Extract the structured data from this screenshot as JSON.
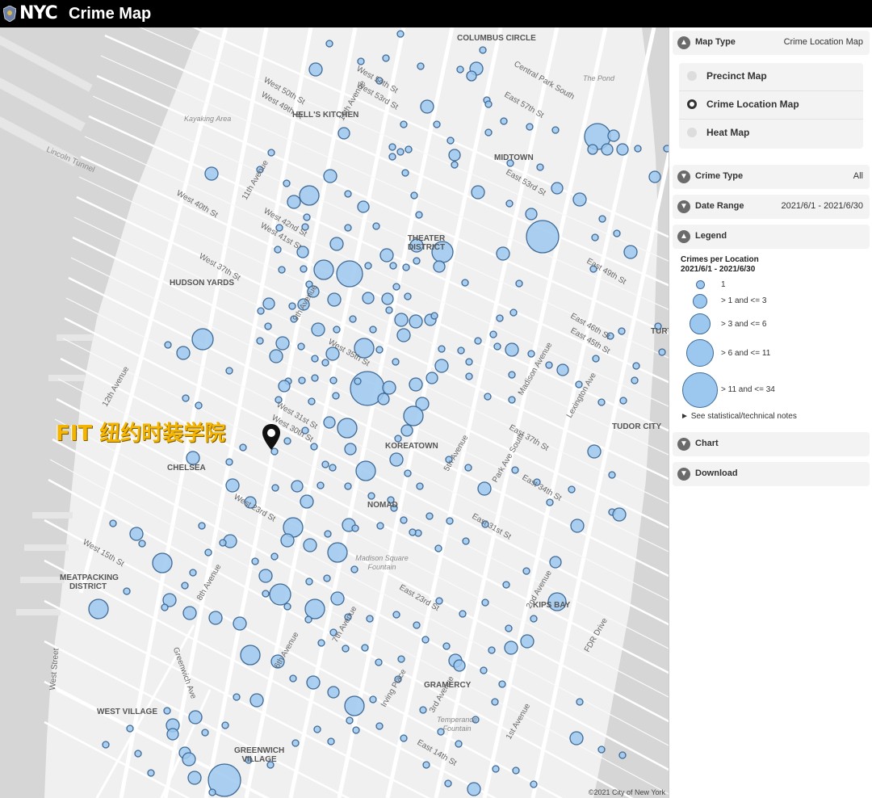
{
  "header": {
    "logo": "NYC",
    "title": "Crime Map"
  },
  "map": {
    "neighborhoods": [
      "COLUMBUS CIRCLE",
      "HELL'S KITCHEN",
      "MIDTOWN",
      "THEATER DISTRICT",
      "HUDSON YARDS",
      "TUDOR CITY",
      "KOREATOWN",
      "CHELSEA",
      "NOMAD",
      "MEATPACKING DISTRICT",
      "KIPS BAY",
      "GRAMERCY",
      "WEST VILLAGE",
      "GREENWICH VILLAGE",
      "TURTLE BAY"
    ],
    "streets": [
      "West 50th St",
      "West 49th St",
      "West 54th St",
      "West 53rd St",
      "11th Avenue",
      "12th Avenue",
      "10th Avenue",
      "9th Avenue",
      "8th Avenue",
      "7th Avenue",
      "6th Avenue",
      "5th Avenue",
      "Madison Avenue",
      "Park Ave South",
      "Lexington Ave",
      "3rd Avenue",
      "2nd Avenue",
      "1st Avenue",
      "West 42nd St",
      "West 41st St",
      "West 40th St",
      "West 37th St",
      "West 35th St",
      "West 31st St",
      "West 30th St",
      "West 23rd St",
      "West 15th St",
      "East 57th St",
      "East 53rd St",
      "East 49th St",
      "East 46th St",
      "East 45th St",
      "East 37th St",
      "East 34th St",
      "East 31st St",
      "East 23rd St",
      "East 14th St",
      "Irving Place",
      "West Street",
      "Greenwich Ave",
      "FDR Drive",
      "Central Park South"
    ],
    "water_labels": [
      "Lincoln Tunnel",
      "Kayaking Area",
      "The Pond"
    ],
    "parks": [
      "Madison Square Fountain",
      "Temperance Fountain"
    ],
    "annotation": "FIT 纽约时装学院",
    "circle_color": "#9cc8f0",
    "circle_stroke": "#3f6a96",
    "copyright": "©2021 City of New York"
  },
  "panel": {
    "map_type": {
      "label": "Map Type",
      "value": "Crime Location Map",
      "options": [
        {
          "label": "Precinct Map",
          "selected": false
        },
        {
          "label": "Crime Location Map",
          "selected": true
        },
        {
          "label": "Heat Map",
          "selected": false
        }
      ]
    },
    "crime_type": {
      "label": "Crime Type",
      "value": "All"
    },
    "date_range": {
      "label": "Date Range",
      "value": "2021/6/1 - 2021/6/30"
    },
    "legend": {
      "label": "Legend",
      "title": "Crimes per Location",
      "subtitle": "2021/6/1 - 2021/6/30",
      "items": [
        "1",
        "> 1 and <= 3",
        "> 3 and <= 6",
        "> 6 and <= 11",
        "> 11 and <= 34"
      ],
      "notes": "See statistical/technical notes"
    },
    "chart": {
      "label": "Chart"
    },
    "download": {
      "label": "Download"
    }
  }
}
